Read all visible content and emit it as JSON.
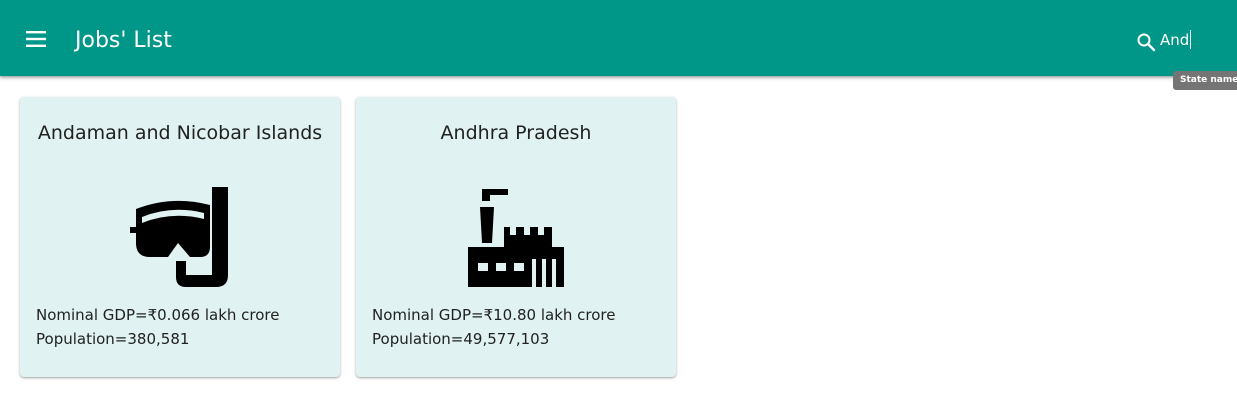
{
  "appbar": {
    "title": "Jobs' List",
    "menu_icon": "menu-icon",
    "search_icon": "search-icon",
    "search_value": "And",
    "tooltip": "State names",
    "background": "#009688"
  },
  "cards": [
    {
      "title": "Andaman and Nicobar Islands",
      "icon": "snorkel-mask-icon",
      "gdp": "Nominal GDP=₹0.066 lakh crore",
      "population": "Population=380,581"
    },
    {
      "title": "Andhra Pradesh",
      "icon": "factory-icon",
      "gdp": "Nominal GDP=₹10.80 lakh crore",
      "population": "Population=49,577,103"
    }
  ],
  "colors": {
    "card_background": "#e0f2f1",
    "text": "#212121"
  }
}
